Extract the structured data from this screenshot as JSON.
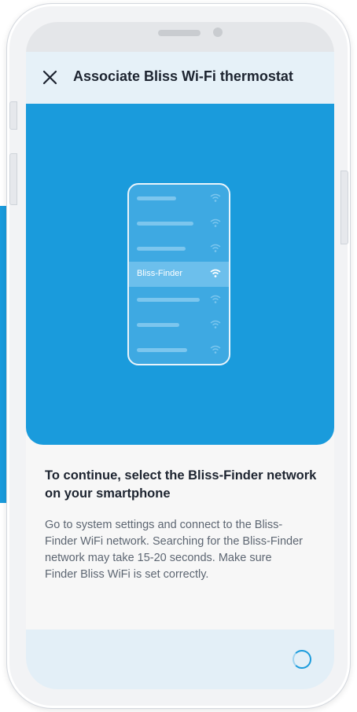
{
  "header": {
    "title": "Associate Bliss Wi-Fi thermostat",
    "close_icon": "close-icon"
  },
  "illustration": {
    "selected_network": "Bliss-Finder",
    "network_count": 7,
    "icon": "wifi-icon"
  },
  "content": {
    "heading": "To continue, select the Bliss-Finder network on your smartphone",
    "body": "Go to system settings and connect to the Bliss-Finder WiFi network. Searching for the Bliss-Finder network may take 15-20 seconds. Make sure Finder Bliss WiFi is set correctly."
  },
  "footer": {
    "status_icon": "loading-spinner-icon"
  },
  "colors": {
    "accent": "#1a9bdc",
    "header_bg": "#e6f1f8",
    "footer_bg": "#e3eff7",
    "text_dark": "#1d2430",
    "text_muted": "#5d6672"
  }
}
